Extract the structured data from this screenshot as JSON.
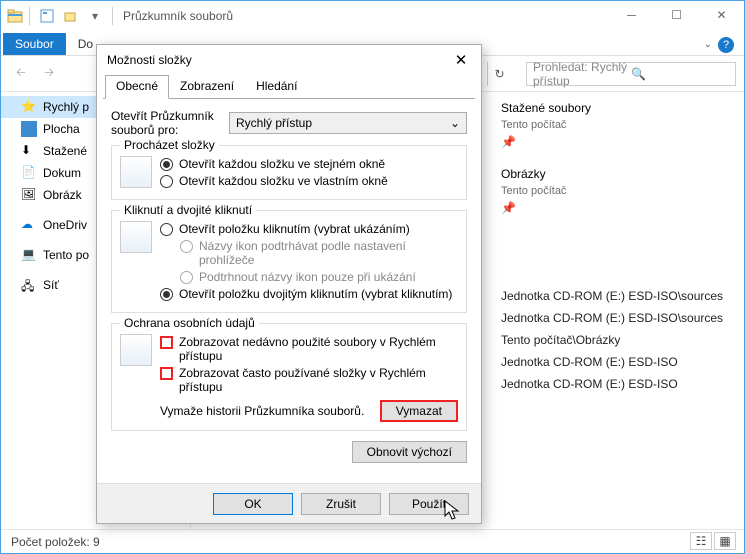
{
  "window": {
    "title": "Průzkumník souborů",
    "search_placeholder": "Prohledat: Rychlý přístup",
    "status": "Počet položek: 9"
  },
  "ribbon": {
    "file": "Soubor",
    "home": "Do",
    "share": "",
    "view": ""
  },
  "tree": {
    "quick": "Rychlý p",
    "desktop": "Plocha",
    "downloads": "Stažené",
    "documents": "Dokum",
    "pictures": "Obrázk",
    "onedrive": "OneDriv",
    "thispc": "Tento po",
    "network": "Síť"
  },
  "content": {
    "downloads": {
      "name": "Stažené soubory",
      "loc": "Tento počítač"
    },
    "pictures": {
      "name": "Obrázky",
      "loc": "Tento počítač"
    },
    "recent": [
      "Jednotka CD-ROM (E:) ESD-ISO\\sources",
      "Jednotka CD-ROM (E:) ESD-ISO\\sources",
      "Tento počítač\\Obrázky",
      "Jednotka CD-ROM (E:) ESD-ISO",
      "Jednotka CD-ROM (E:) ESD-ISO"
    ]
  },
  "dialog": {
    "title": "Možnosti složky",
    "tabs": {
      "general": "Obecné",
      "view": "Zobrazení",
      "search": "Hledání"
    },
    "open_label": "Otevřít Průzkumník souborů pro:",
    "open_value": "Rychlý přístup",
    "browse": {
      "title": "Procházet složky",
      "same": "Otevřít každou složku ve stejném okně",
      "own": "Otevřít každou složku ve vlastním okně"
    },
    "click": {
      "title": "Kliknutí a dvojité kliknutí",
      "single": "Otevřít položku kliknutím (vybrat ukázáním)",
      "underline_browser": "Názvy ikon podtrhávat podle nastavení prohlížeče",
      "underline_point": "Podtrhnout názvy ikon pouze při ukázání",
      "double": "Otevřít položku dvojitým kliknutím (vybrat kliknutím)"
    },
    "privacy": {
      "title": "Ochrana osobních údajů",
      "recent_files": "Zobrazovat nedávno použité soubory v Rychlém přístupu",
      "freq_folders": "Zobrazovat často používané složky v Rychlém přístupu",
      "clear_label": "Vymaže historii Průzkumníka souborů.",
      "clear_btn": "Vymazat"
    },
    "restore": "Obnovit výchozí",
    "ok": "OK",
    "cancel": "Zrušit",
    "apply": "Použít"
  }
}
